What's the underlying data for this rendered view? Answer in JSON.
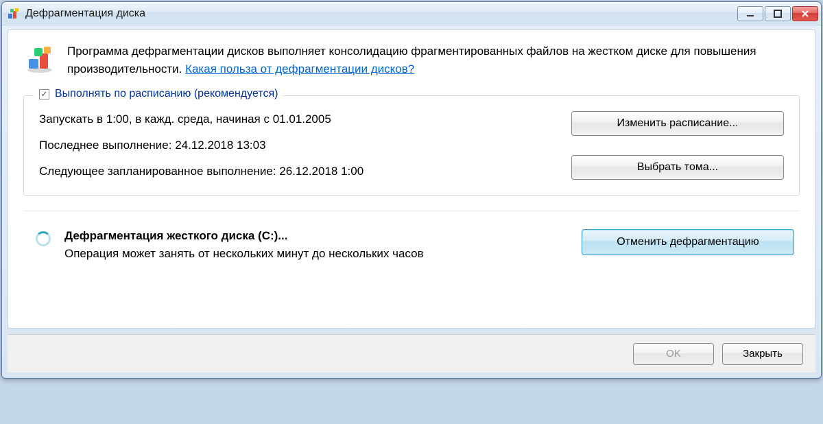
{
  "window": {
    "title": "Дефрагментация диска"
  },
  "intro": {
    "text": "Программа дефрагментации дисков выполняет консолидацию фрагментированных файлов на жестком диске для повышения производительности. ",
    "link": "Какая польза от дефрагментации дисков?"
  },
  "schedule": {
    "checkbox_label": "Выполнять по расписанию (рекомендуется)",
    "checked": true,
    "run_at": "Запускать в 1:00, в кажд. среда, начиная с 01.01.2005",
    "last_run": "Последнее выполнение: 24.12.2018 13:03",
    "next_run": "Следующее запланированное выполнение: 26.12.2018 1:00",
    "btn_change": "Изменить расписание...",
    "btn_volumes": "Выбрать тома..."
  },
  "progress": {
    "title": "Дефрагментация жесткого диска (C:)...",
    "subtitle": "Операция может занять от нескольких минут до нескольких часов",
    "btn_cancel": "Отменить дефрагментацию"
  },
  "footer": {
    "ok": "OK",
    "close": "Закрыть"
  }
}
